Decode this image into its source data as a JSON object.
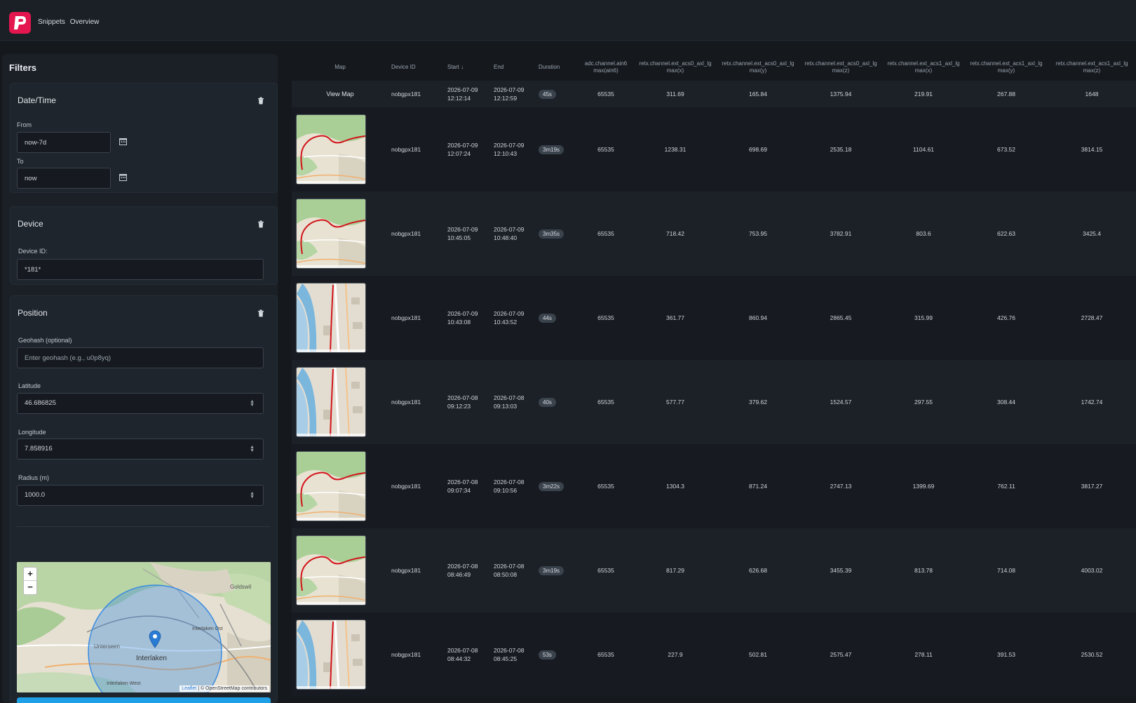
{
  "header": {
    "breadcrumb": [
      "Snippets",
      "Overview"
    ]
  },
  "filters": {
    "title": "Filters",
    "datetime": {
      "title": "Date/Time",
      "from_label": "From",
      "from_value": "now-7d",
      "to_label": "To",
      "to_value": "now"
    },
    "device": {
      "title": "Device",
      "device_label": "Device ID:",
      "device_value": "*181*"
    },
    "position": {
      "title": "Position",
      "geohash_label": "Geohash (optional)",
      "geohash_placeholder": "Enter geohash (e.g., u0p8yq)",
      "latitude_label": "Latitude",
      "latitude_value": "46.686825",
      "longitude_label": "Longitude",
      "longitude_value": "7.858916",
      "radius_label": "Radius (m)",
      "radius_value": "1000.0"
    },
    "map": {
      "labels": [
        "Goldswil",
        "Unterseen",
        "Interlaken Ost",
        "Interlaken",
        "Interlaken West"
      ],
      "zoom_in": "+",
      "zoom_out": "−",
      "attribution_leaflet": "Leaflet",
      "attribution_osm": "| © OpenStreetMap contributors"
    }
  },
  "table": {
    "headers": [
      "Map",
      "Device ID",
      "Start ↓",
      "End",
      "Duration",
      "adc.channel.ain6 max(ain6)",
      "retx.channel.ext_acs0_axl_lg max(x)",
      "retx.channel.ext_acs0_axl_lg max(y)",
      "retx.channel.ext_acs0_axl_lg max(z)",
      "retx.channel.ext_acs1_axl_lg max(x)",
      "retx.channel.ext_acs1_axl_lg max(y)",
      "retx.channel.ext_acs1_axl_lg max(z)"
    ],
    "view_map_label": "View Map",
    "rows": [
      {
        "device": "nobgpx181",
        "start_date": "2026-07-09",
        "start_time": "12:12:14",
        "end_date": "2026-07-09",
        "end_time": "12:12:59",
        "duration": "45s",
        "ain6": "65535",
        "a0x": "311.69",
        "a0y": "165.84",
        "a0z": "1375.94",
        "a1x": "219.91",
        "a1y": "267.88",
        "a1z": "1648"
      },
      {
        "device": "nobgpx181",
        "start_date": "2026-07-09",
        "start_time": "12:07:24",
        "end_date": "2026-07-09",
        "end_time": "12:10:43",
        "duration": "3m19s",
        "ain6": "65535",
        "a0x": "1238.31",
        "a0y": "698.69",
        "a0z": "2535.18",
        "a1x": "1104.61",
        "a1y": "673.52",
        "a1z": "3814.15"
      },
      {
        "device": "nobgpx181",
        "start_date": "2026-07-09",
        "start_time": "10:45:05",
        "end_date": "2026-07-09",
        "end_time": "10:48:40",
        "duration": "3m35s",
        "ain6": "65535",
        "a0x": "718.42",
        "a0y": "753.95",
        "a0z": "3782.91",
        "a1x": "803.6",
        "a1y": "622.63",
        "a1z": "3425.4"
      },
      {
        "device": "nobgpx181",
        "start_date": "2026-07-09",
        "start_time": "10:43:08",
        "end_date": "2026-07-09",
        "end_time": "10:43:52",
        "duration": "44s",
        "ain6": "65535",
        "a0x": "361.77",
        "a0y": "860.94",
        "a0z": "2865.45",
        "a1x": "315.99",
        "a1y": "426.76",
        "a1z": "2728.47"
      },
      {
        "device": "nobgpx181",
        "start_date": "2026-07-08",
        "start_time": "09:12:23",
        "end_date": "2026-07-08",
        "end_time": "09:13:03",
        "duration": "40s",
        "ain6": "65535",
        "a0x": "577.77",
        "a0y": "379.62",
        "a0z": "1524.57",
        "a1x": "297.55",
        "a1y": "308.44",
        "a1z": "1742.74"
      },
      {
        "device": "nobgpx181",
        "start_date": "2026-07-08",
        "start_time": "09:07:34",
        "end_date": "2026-07-08",
        "end_time": "09:10:56",
        "duration": "3m22s",
        "ain6": "65535",
        "a0x": "1304.3",
        "a0y": "871.24",
        "a0z": "2747.13",
        "a1x": "1399.69",
        "a1y": "762.11",
        "a1z": "3817.27"
      },
      {
        "device": "nobgpx181",
        "start_date": "2026-07-08",
        "start_time": "08:46:49",
        "end_date": "2026-07-08",
        "end_time": "08:50:08",
        "duration": "3m19s",
        "ain6": "65535",
        "a0x": "817.29",
        "a0y": "626.68",
        "a0z": "3455.39",
        "a1x": "813.78",
        "a1y": "714.08",
        "a1z": "4003.02"
      },
      {
        "device": "nobgpx181",
        "start_date": "2026-07-08",
        "start_time": "08:44:32",
        "end_date": "2026-07-08",
        "end_time": "08:45:25",
        "duration": "53s",
        "ain6": "65535",
        "a0x": "227.9",
        "a0y": "502.81",
        "a0z": "2575.47",
        "a1x": "278.11",
        "a1y": "391.53",
        "a1z": "2530.52"
      }
    ],
    "thumb_types": [
      "none",
      "green",
      "green",
      "city",
      "city",
      "green",
      "green",
      "city"
    ]
  },
  "colors": {
    "brand": "#e3164f",
    "accent": "#1fa0e6",
    "route": "#d2131a",
    "radius": "#3a8be0"
  },
  "icons": {
    "trash": "trash-icon",
    "calendar": "calendar-icon",
    "logo": "logo-icon"
  }
}
